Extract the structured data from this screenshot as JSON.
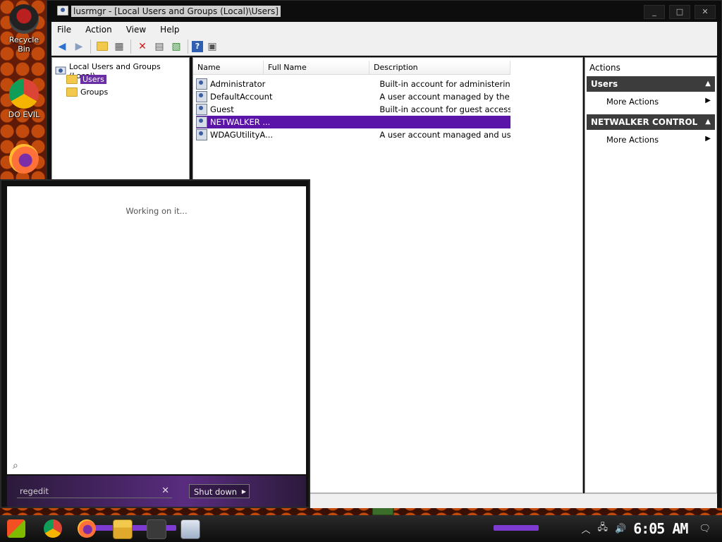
{
  "desktop": {
    "icons": [
      {
        "label": "Recycle Bin",
        "icon": "recycle-bin-icon"
      },
      {
        "label": "DO EVIL",
        "icon": "chrome-icon"
      },
      {
        "label": "",
        "icon": "firefox-icon"
      }
    ]
  },
  "window": {
    "title": "lusrmgr - [Local Users and Groups (Local)\\Users]",
    "controls": {
      "minimize": "_",
      "maximize": "□",
      "close": "✕"
    }
  },
  "menu": [
    "File",
    "Action",
    "View",
    "Help"
  ],
  "toolbar": {
    "buttons": [
      "back-icon",
      "forward-icon",
      "up-folder-icon",
      "show-hide-tree-icon",
      "delete-icon",
      "properties-icon",
      "export-icon",
      "help-icon",
      "show-hide-action-pane-icon"
    ]
  },
  "tree": {
    "root": "Local Users and Groups (Local)",
    "children": [
      "Users",
      "Groups"
    ],
    "selected": "Users"
  },
  "list": {
    "columns": [
      "Name",
      "Full Name",
      "Description"
    ],
    "rows": [
      {
        "name": "Administrator",
        "full_name": "",
        "description": "Built-in account for administering the ..."
      },
      {
        "name": "DefaultAccount",
        "full_name": "",
        "description": "A user account managed by the syst..."
      },
      {
        "name": "Guest",
        "full_name": "",
        "description": "Built-in account for guest access to th..."
      },
      {
        "name": "NETWALKER ...",
        "full_name": "",
        "description": ""
      },
      {
        "name": "WDAGUtilityA...",
        "full_name": "",
        "description": "A user account managed and used b..."
      }
    ],
    "selected_index": 3
  },
  "actions": {
    "title": "Actions",
    "sections": [
      {
        "header": "Users",
        "items": [
          "More Actions"
        ]
      },
      {
        "header": "NETWALKER CONTROL",
        "items": [
          "More Actions"
        ]
      }
    ]
  },
  "start_menu": {
    "status": "Working on it...",
    "search_value": "regedit",
    "clear": "✕",
    "shutdown_label": "Shut down"
  },
  "taskbar": {
    "apps": [
      "start-icon",
      "chrome-icon",
      "firefox-icon",
      "file-explorer-icon",
      "character-icon",
      "computer-management-icon"
    ],
    "clock": "6:05 AM"
  },
  "colors": {
    "selection": "#5a14a8",
    "taskbar_accent": "#7d3bd1",
    "action_header": "#3c3c3c"
  }
}
